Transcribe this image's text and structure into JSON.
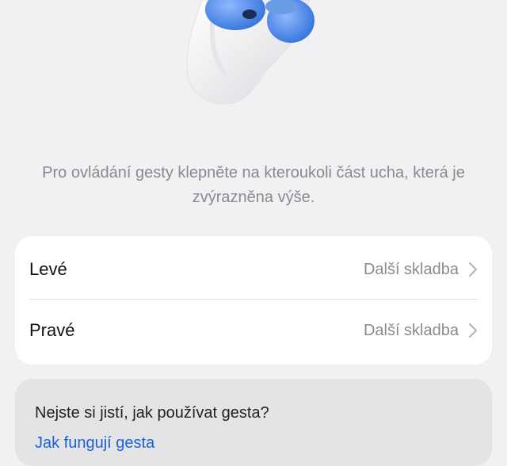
{
  "instruction": "Pro ovládání gesty klepněte na kteroukoli část ucha, která je zvýrazněna výše.",
  "settings": {
    "rows": [
      {
        "label": "Levé",
        "value": "Další skladba"
      },
      {
        "label": "Pravé",
        "value": "Další skladba"
      }
    ]
  },
  "help": {
    "question": "Nejste si jistí, jak používat gesta?",
    "link": "Jak fungují gesta"
  },
  "colors": {
    "background": "#f1f1f3",
    "card": "#ffffff",
    "earbud_highlight": "#3a7be0",
    "link": "#1b62d6"
  }
}
